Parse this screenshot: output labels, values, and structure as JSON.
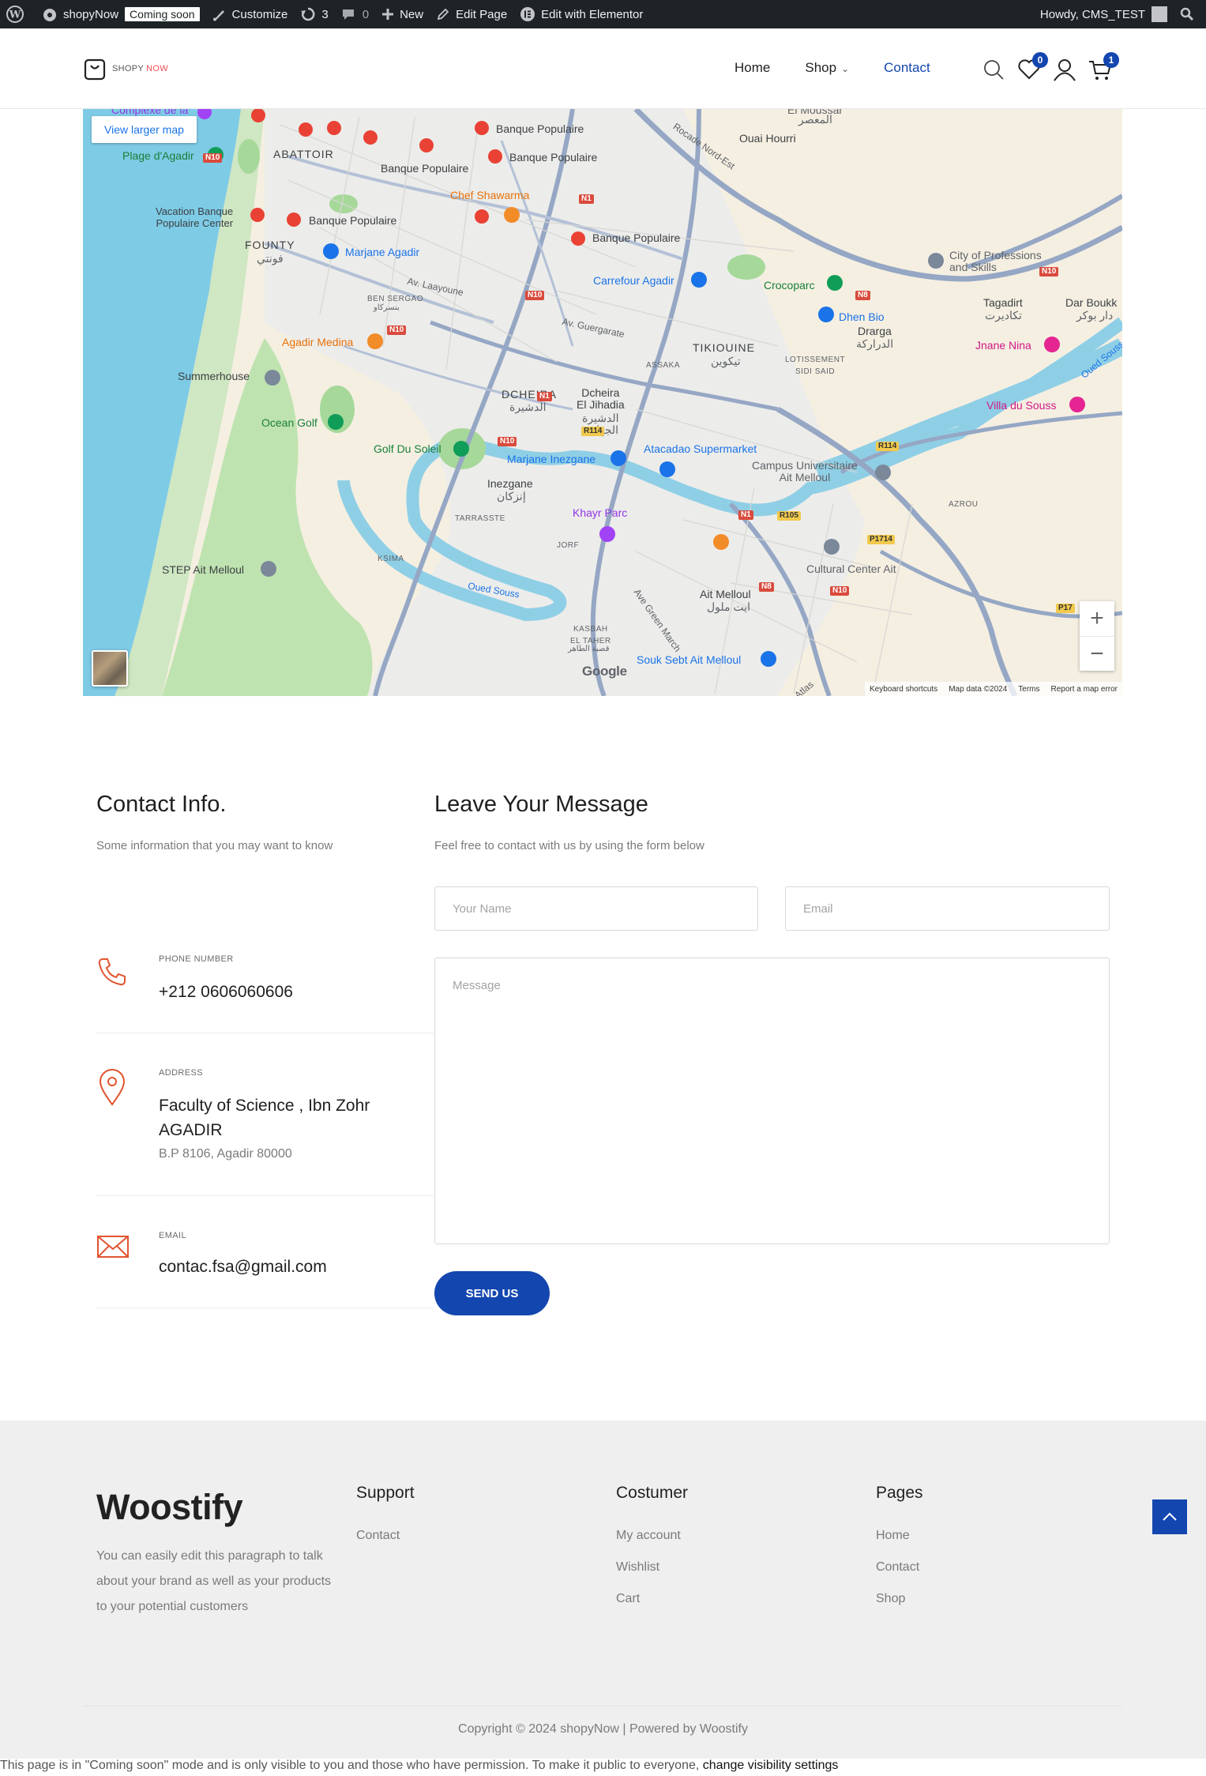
{
  "admin_bar": {
    "site_name": "shopyNow",
    "coming_soon": "Coming soon",
    "customize": "Customize",
    "updates_count": "3",
    "comments_count": "0",
    "new": "New",
    "edit_page": "Edit Page",
    "edit_elementor": "Edit with Elementor",
    "howdy": "Howdy, CMS_TEST"
  },
  "header": {
    "logo_part1": "SHOPY",
    "logo_part2": "NOW",
    "nav": [
      {
        "label": "Home"
      },
      {
        "label": "Shop"
      },
      {
        "label": "Contact"
      }
    ],
    "wishlist_count": "0",
    "cart_count": "1"
  },
  "map": {
    "view_larger": "View larger map",
    "zoom_in": "+",
    "zoom_out": "−",
    "google": "Google",
    "footer": [
      "Keyboard shortcuts",
      "Map data ©2024",
      "Terms",
      "Report a map error"
    ],
    "labels": {
      "banque1": "Banque Populaire",
      "banque2": "Banque Populaire",
      "banque3": "Banque Populaire",
      "banque4": "Banque Populaire",
      "banque5": "Banque Populaire",
      "ouai": "Ouai Hourri",
      "plage": "Plage d'Agadir",
      "abattoir": "ABATTOIR",
      "chef": "Chef Shawarma",
      "vacation": "Vacation Banque\nPopulaire Center",
      "founty": "FOUNTY",
      "founty_ar": "فونتي",
      "marjane_agadir": "Marjane Agadir",
      "carrefour": "Carrefour Agadir",
      "crocoparc": "Crocoparc",
      "city_prof": "City of Professions\nand Skills",
      "tagadirt": "Tagadirt",
      "tagadirt_ar": "تكاديرت",
      "dar_boukka": "Dar Boukk",
      "dar_boukka_ar": "دار بوكر",
      "dhen": "Dhen Bio",
      "drarga": "Drarga",
      "drarga_ar": "الدراركة",
      "jnane": "Jnane Nina",
      "agadir_medina": "Agadir Medina",
      "tikiouine": "TIKIOUINE",
      "tikiouine_ar": "تيكوين",
      "assaka": "ASSAKA",
      "lotissement": "LOTISSEMENT\nSIDI SAID",
      "summerhouse": "Summerhouse",
      "dcheira": "DCHEIRA",
      "dcheira_ar": "الدشيرة",
      "dcheira_jihadia": "Dcheira\nEl Jihadia",
      "dcheira_jihadia_ar": "الدشيرة\nالجهادية",
      "villa": "Villa du Souss",
      "ocean_golf": "Ocean Golf",
      "golf_soleil": "Golf Du Soleil",
      "marjane_inez": "Marjane Inezgane",
      "atacadao": "Atacadao Supermarket",
      "campus": "Campus Universitaire\nAit Melloul",
      "inezgane": "Inezgane",
      "inezgane_ar": "إنزكان",
      "tarrasste": "TARRASSTE",
      "khayr": "Khayr Parc",
      "azrou": "AZROU",
      "jorf": "JORF",
      "ksima": "KSIMA",
      "step": "STEP Ait Melloul",
      "cultural": "Cultural Center Ait",
      "ait_melloul": "Ait Melloul",
      "ait_melloul_ar": "ايت ملول",
      "kasbah": "KASBAH\nEL TAHER",
      "kasbah_ar": "قصبة الطاهر",
      "souk": "Souk Sebt Ait Melloul",
      "oued_souss": "Oued Souss",
      "oued_souss2": "Oued Souss",
      "ben_sergao": "BEN SERGAO",
      "ben_sergao_ar": "بنسركاو",
      "av_laayoune": "Av. Laayoune",
      "av_guergarate": "Av. Guergarate",
      "rocade": "Rocade Nord-Est",
      "ave_green": "Ave Green March",
      "el_moussar": "El Moussar",
      "el_moussar_ar": "المعصر",
      "comple": "Complexe de la",
      "atlas": "Atlas"
    },
    "roads": [
      "N10",
      "N1",
      "N8",
      "N10",
      "N10",
      "N1",
      "N10",
      "R114",
      "R114",
      "N1",
      "R105",
      "P1714",
      "N8",
      "N10",
      "N10",
      "P17"
    ]
  },
  "contact_info": {
    "title": "Contact Info.",
    "subtitle": "Some information that you may want to know",
    "phone_label": "PHONE NUMBER",
    "phone": "+212 0606060606",
    "address_label": "ADDRESS",
    "address": "Faculty of Science , Ibn Zohr AGADIR",
    "address_sub": "B.P 8106, Agadir 80000",
    "email_label": "EMAIL",
    "email": "contac.fsa@gmail.com"
  },
  "message_form": {
    "title": "Leave Your Message",
    "subtitle": "Feel free to contact with us by using the form below",
    "name_placeholder": "Your Name",
    "email_placeholder": "Email",
    "message_placeholder": "Message",
    "send_label": "SEND US"
  },
  "footer": {
    "brand": "Woostify",
    "description": "You can easily edit this paragraph to talk about your brand as well as your products to your potential customers",
    "support_title": "Support",
    "support_links": [
      "Contact"
    ],
    "customer_title": "Costumer",
    "customer_links": [
      "My account",
      "Wishlist",
      "Cart"
    ],
    "pages_title": "Pages",
    "pages_links": [
      "Home",
      "Contact",
      "Shop"
    ],
    "copyright": "Copyright © 2024 shopyNow | Powered by Woostify"
  },
  "notice": {
    "text": "This page is in \"Coming soon\" mode and is only visible to you and those who have permission. To make it public to everyone, ",
    "link": "change visibility settings"
  },
  "colors": {
    "accent": "#1346af",
    "logo_accent": "#ef4b54",
    "icon_accent": "#e2542f",
    "adminbar": "#1d2327",
    "footer_bg": "#efefef"
  }
}
